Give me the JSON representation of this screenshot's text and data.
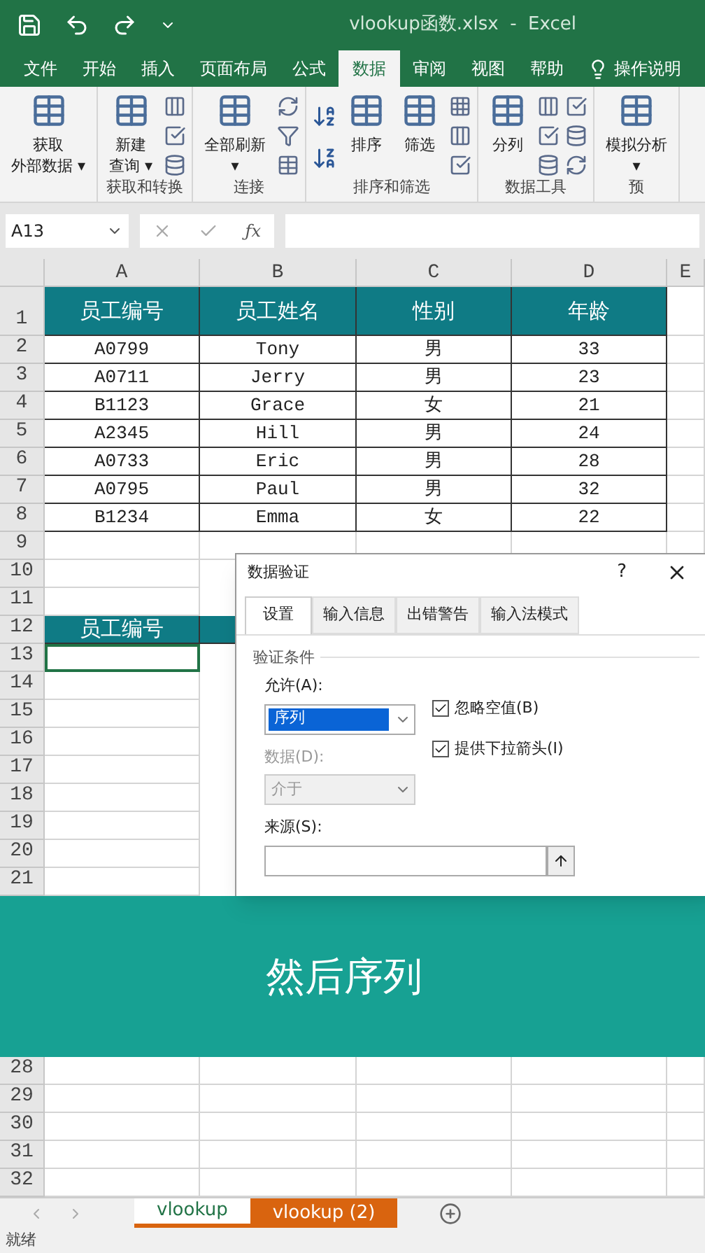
{
  "title_bar": {
    "title": "vlookup函数.xlsx  -  Excel"
  },
  "ribbon_tabs": [
    {
      "label": "文件",
      "selected": false
    },
    {
      "label": "开始",
      "selected": false
    },
    {
      "label": "插入",
      "selected": false
    },
    {
      "label": "页面布局",
      "selected": false
    },
    {
      "label": "公式",
      "selected": false
    },
    {
      "label": "数据",
      "selected": true
    },
    {
      "label": "审阅",
      "selected": false
    },
    {
      "label": "视图",
      "selected": false
    },
    {
      "label": "帮助",
      "selected": false
    }
  ],
  "tell_me": "操作说明",
  "ribbon_groups": [
    {
      "items": [
        {
          "kind": "large",
          "lines": [
            "获取",
            "外部数据 ▾"
          ]
        }
      ]
    },
    {
      "label": "获取和转换",
      "items": [
        {
          "kind": "large",
          "lines": [
            "新建",
            "查询 ▾"
          ]
        },
        {
          "kind": "smallcol"
        }
      ]
    },
    {
      "label": "连接",
      "items": [
        {
          "kind": "large",
          "lines": [
            "全部刷新",
            "▾"
          ]
        },
        {
          "kind": "smallcol"
        }
      ]
    },
    {
      "label": "排序和筛选",
      "items": [
        {
          "kind": "sortcol"
        },
        {
          "kind": "large",
          "lines": [
            "排序"
          ]
        },
        {
          "kind": "large",
          "lines": [
            "筛选"
          ]
        },
        {
          "kind": "smallcol"
        }
      ]
    },
    {
      "label": "数据工具",
      "items": [
        {
          "kind": "large",
          "lines": [
            "分列"
          ]
        },
        {
          "kind": "smallcol"
        },
        {
          "kind": "smallcol"
        }
      ]
    },
    {
      "label": "预",
      "items": [
        {
          "kind": "large",
          "lines": [
            "模拟分析",
            "▾"
          ]
        }
      ]
    }
  ],
  "formula_bar": {
    "name_box": "A13",
    "fx_label": "ƒx"
  },
  "columns": [
    "A",
    "B",
    "C",
    "D",
    "E"
  ],
  "rows": [
    {
      "number": "1",
      "cells": [
        {
          "kind": "header",
          "text": "员工编号"
        },
        {
          "kind": "header",
          "text": "员工姓名"
        },
        {
          "kind": "header",
          "text": "性别"
        },
        {
          "kind": "header",
          "text": "年龄"
        }
      ]
    },
    {
      "number": "2",
      "cells": [
        {
          "kind": "data",
          "text": "A0799"
        },
        {
          "kind": "data",
          "text": "Tony"
        },
        {
          "kind": "data",
          "text": "男"
        },
        {
          "kind": "data",
          "text": "33"
        }
      ]
    },
    {
      "number": "3",
      "cells": [
        {
          "kind": "data",
          "text": "A0711"
        },
        {
          "kind": "data",
          "text": "Jerry"
        },
        {
          "kind": "data",
          "text": "男"
        },
        {
          "kind": "data",
          "text": "23"
        }
      ]
    },
    {
      "number": "4",
      "cells": [
        {
          "kind": "data",
          "text": "B1123"
        },
        {
          "kind": "data",
          "text": "Grace"
        },
        {
          "kind": "data",
          "text": "女"
        },
        {
          "kind": "data",
          "text": "21"
        }
      ]
    },
    {
      "number": "5",
      "cells": [
        {
          "kind": "data",
          "text": "A2345"
        },
        {
          "kind": "data",
          "text": "Hill"
        },
        {
          "kind": "data",
          "text": "男"
        },
        {
          "kind": "data",
          "text": "24"
        }
      ]
    },
    {
      "number": "6",
      "cells": [
        {
          "kind": "data",
          "text": "A0733"
        },
        {
          "kind": "data",
          "text": "Eric"
        },
        {
          "kind": "data",
          "text": "男"
        },
        {
          "kind": "data",
          "text": "28"
        }
      ]
    },
    {
      "number": "7",
      "cells": [
        {
          "kind": "data",
          "text": "A0795"
        },
        {
          "kind": "data",
          "text": "Paul"
        },
        {
          "kind": "data",
          "text": "男"
        },
        {
          "kind": "data",
          "text": "32"
        }
      ]
    },
    {
      "number": "8",
      "cells": [
        {
          "kind": "data",
          "text": "B1234"
        },
        {
          "kind": "data",
          "text": "Emma"
        },
        {
          "kind": "data",
          "text": "女"
        },
        {
          "kind": "data",
          "text": "22"
        }
      ]
    },
    {
      "number": "9"
    },
    {
      "number": "10"
    },
    {
      "number": "11"
    },
    {
      "number": "12",
      "cells": [
        {
          "kind": "header",
          "text": "员工编号"
        },
        {
          "kind": "header"
        }
      ]
    },
    {
      "number": "13",
      "cells": [
        {
          "kind": "selected"
        }
      ]
    },
    {
      "number": "14"
    },
    {
      "number": "15"
    },
    {
      "number": "16"
    },
    {
      "number": "17"
    },
    {
      "number": "18"
    },
    {
      "number": "19"
    },
    {
      "number": "20"
    },
    {
      "number": "21"
    }
  ],
  "caption": "然后序列",
  "rows_below": [
    {
      "number": "28"
    },
    {
      "number": "29"
    },
    {
      "number": "30"
    },
    {
      "number": "31"
    },
    {
      "number": "32"
    }
  ],
  "dialog": {
    "title": "数据验证",
    "help": "?",
    "tabs": [
      {
        "label": "设置",
        "selected": true
      },
      {
        "label": "输入信息",
        "selected": false
      },
      {
        "label": "出错警告",
        "selected": false
      },
      {
        "label": "输入法模式",
        "selected": false
      }
    ],
    "section": "验证条件",
    "allow": {
      "label": "允许(A):",
      "value": "序列"
    },
    "data": {
      "label": "数据(D):",
      "value": "介于",
      "disabled": true
    },
    "checkboxes": [
      {
        "label": "忽略空值(B)",
        "checked": true
      },
      {
        "label": "提供下拉箭头(I)",
        "checked": true
      }
    ],
    "source": {
      "label": "来源(S):"
    }
  },
  "sheet_tabs": [
    {
      "label": "vlookup",
      "selected": true,
      "color": "#d9640f"
    },
    {
      "label": "vlookup (2)",
      "selected": false,
      "color": "#d9640f"
    }
  ],
  "status_bar": {
    "text": "就绪"
  }
}
